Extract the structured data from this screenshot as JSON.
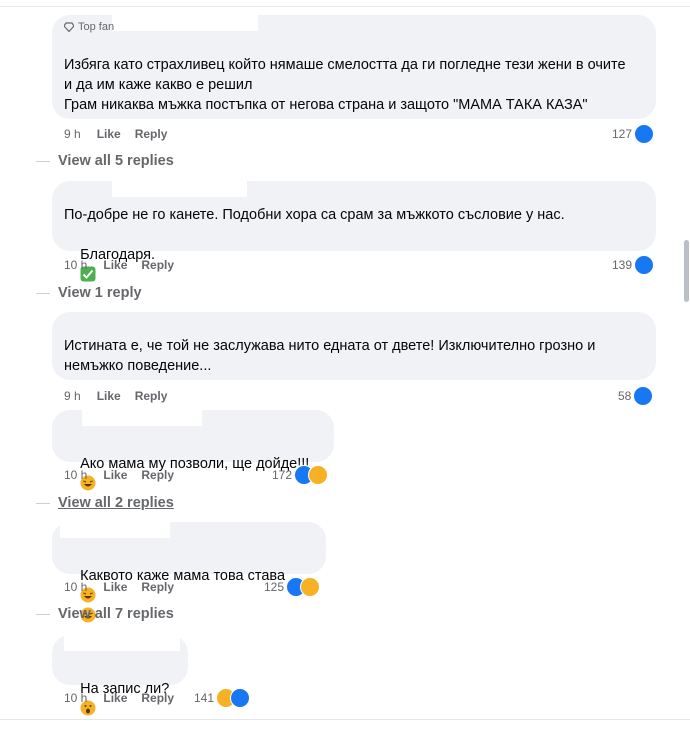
{
  "comments": [
    {
      "badge": "Top fan",
      "lines": [
        "Избяга като страхливец който нямаше смелостта да ги погледне тези жени в очите",
        "и да им каже какво е решил",
        "Грам никаква мъжка постъпка от негова страна и защото \"МАМА ТАКА КАЗА\""
      ],
      "time": "9 h",
      "like": "Like",
      "reply": "Reply",
      "reactions": "127",
      "view_replies": "View all 5 replies"
    },
    {
      "lines": [
        "По-добре не го канете. Подобни хора са срам за мъжкото съсловие у нас.",
        "Благодаря."
      ],
      "time": "10 h",
      "like": "Like",
      "reply": "Reply",
      "reactions": "139",
      "view_replies": "View 1 reply"
    },
    {
      "lines": [
        "Истината е, че той не заслужава нито едната от двете! Изключително грозно и",
        "немъжко поведение..."
      ],
      "time": "9 h",
      "like": "Like",
      "reply": "Reply",
      "reactions": "58"
    },
    {
      "lines": [
        "Ако мама му позволи, ще дойде!!!"
      ],
      "time": "10 h",
      "like": "Like",
      "reply": "Reply",
      "reactions": "172",
      "view_replies": "View all 2 replies"
    },
    {
      "lines": [
        "Каквото каже мама това става"
      ],
      "time": "10 h",
      "like": "Like",
      "reply": "Reply",
      "reactions": "125",
      "view_replies": "View all 7 replies"
    },
    {
      "lines": [
        "На запис ли?"
      ],
      "time": "10 h",
      "like": "Like",
      "reply": "Reply",
      "reactions": "141"
    }
  ],
  "colors": {
    "bubble": "#f0f2f5",
    "like": "#1877f2",
    "haha": "#f7b125",
    "meta": "#65676b"
  },
  "icons": {
    "like": "like-reaction-icon",
    "haha": "haha-reaction-icon",
    "check": "check-mark-emoji",
    "laugh": "laughing-emoji",
    "shock": "shocked-emoji",
    "diamond": "diamond-icon"
  }
}
